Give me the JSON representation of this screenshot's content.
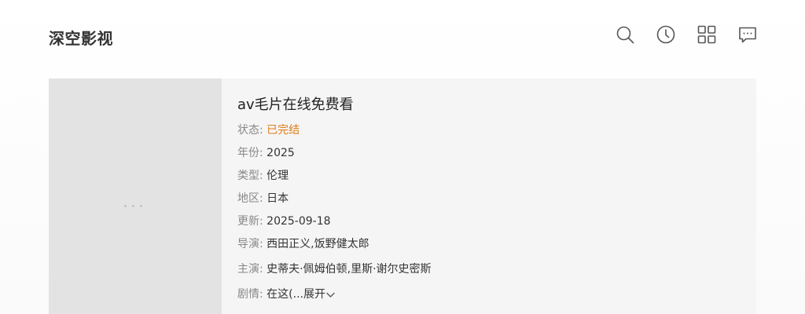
{
  "header": {
    "site_title": "深空影视",
    "icons": [
      "search-icon",
      "history-icon",
      "grid-icon",
      "message-icon"
    ]
  },
  "detail": {
    "title": "av毛片在线免费看",
    "colon": ":",
    "fields": {
      "status": {
        "label": "状态",
        "value": "已完结"
      },
      "year": {
        "label": "年份",
        "value": "2025"
      },
      "genre": {
        "label": "类型",
        "value": "伦理"
      },
      "region": {
        "label": "地区",
        "value": "日本"
      },
      "updated": {
        "label": "更新",
        "value": "2025-09-18"
      },
      "director": {
        "label": "导演",
        "value": "西田正义,饭野健太郎"
      },
      "cast": {
        "label": "主演",
        "value": "史蒂夫·佩姆伯顿,里斯·谢尔史密斯"
      },
      "plot": {
        "label": "剧情",
        "value": "在这(...",
        "expand_label": "展开"
      }
    }
  },
  "colors": {
    "status_accent": "#e07d17",
    "label_gray": "#888888",
    "text_dark": "#333333",
    "poster_placeholder": "#e3e3e3",
    "card_background": "#f5f5f5"
  }
}
